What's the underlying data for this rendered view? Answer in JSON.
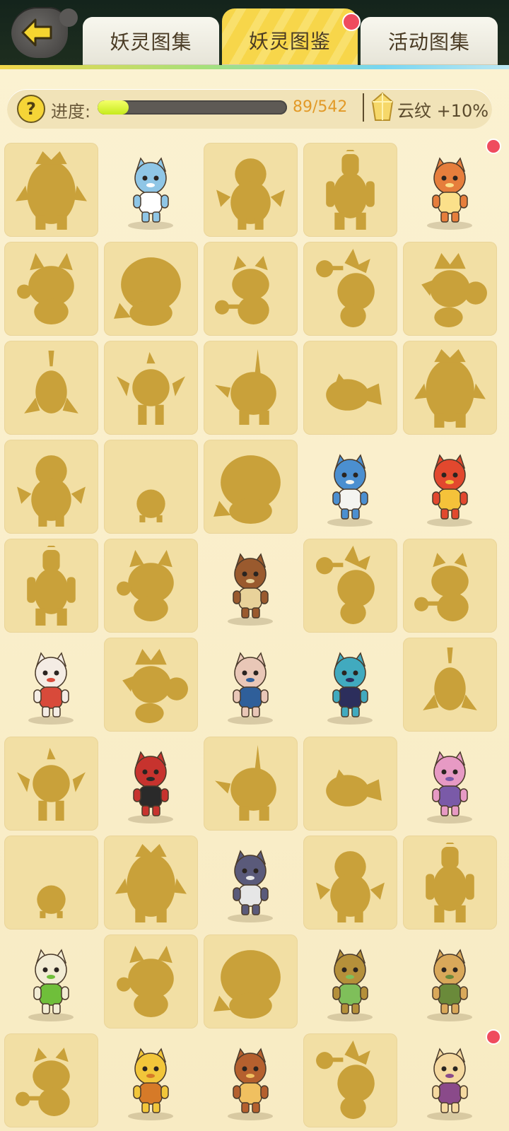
{
  "tabs": [
    {
      "label": "妖灵图集",
      "active": false
    },
    {
      "label": "妖灵图鉴",
      "active": true
    },
    {
      "label": "活动图集",
      "active": false
    }
  ],
  "progress": {
    "label": "进度:",
    "count_text": "89/542",
    "fraction": 0.164,
    "help_symbol": "?",
    "bonus_text": "云纹 +10%"
  },
  "colors": {
    "silhouette": "#c9a13a",
    "locked_bg": "#f2dfa4",
    "accent_yellow": "#f7d64a",
    "progress_green": "#c6ea1c",
    "count_orange": "#e29a28",
    "notify_red": "#ef4c5e"
  },
  "cells": [
    {
      "state": "locked",
      "icon": "monster-silhouette",
      "variant": 0
    },
    {
      "state": "unlocked",
      "icon": "blue-wolf-character",
      "color": "#8fc6e6",
      "accent": "#ffffff"
    },
    {
      "state": "locked",
      "icon": "monster-silhouette",
      "variant": 1
    },
    {
      "state": "locked",
      "icon": "monster-silhouette",
      "variant": 2
    },
    {
      "state": "unlocked",
      "icon": "red-panda-character",
      "color": "#e67e3c",
      "accent": "#fbe08a",
      "badge": true
    },
    {
      "state": "locked",
      "icon": "monster-silhouette",
      "variant": 3
    },
    {
      "state": "locked",
      "icon": "monster-silhouette",
      "variant": 4
    },
    {
      "state": "locked",
      "icon": "monster-silhouette",
      "variant": 5
    },
    {
      "state": "locked",
      "icon": "monster-silhouette",
      "variant": 6
    },
    {
      "state": "locked",
      "icon": "monster-silhouette",
      "variant": 7
    },
    {
      "state": "locked",
      "icon": "monster-silhouette",
      "variant": 8
    },
    {
      "state": "locked",
      "icon": "monster-silhouette",
      "variant": 9
    },
    {
      "state": "locked",
      "icon": "monster-silhouette",
      "variant": 10
    },
    {
      "state": "locked",
      "icon": "monster-silhouette",
      "variant": 11
    },
    {
      "state": "locked",
      "icon": "monster-silhouette",
      "variant": 0
    },
    {
      "state": "locked",
      "icon": "monster-silhouette",
      "variant": 1
    },
    {
      "state": "locked",
      "icon": "monster-silhouette",
      "variant": 12
    },
    {
      "state": "locked",
      "icon": "monster-silhouette",
      "variant": 4
    },
    {
      "state": "unlocked",
      "icon": "frog-staff-character",
      "color": "#4b8fd0",
      "accent": "#f4f4f0"
    },
    {
      "state": "unlocked",
      "icon": "red-lion-character",
      "color": "#e2482e",
      "accent": "#f5c23a"
    },
    {
      "state": "locked",
      "icon": "monster-silhouette",
      "variant": 2
    },
    {
      "state": "locked",
      "icon": "monster-silhouette",
      "variant": 3
    },
    {
      "state": "unlocked",
      "icon": "acorn-warrior-character",
      "color": "#9a5a2e",
      "accent": "#e8d29a"
    },
    {
      "state": "locked",
      "icon": "monster-silhouette",
      "variant": 6
    },
    {
      "state": "locked",
      "icon": "monster-silhouette",
      "variant": 5
    },
    {
      "state": "unlocked",
      "icon": "white-fox-character",
      "color": "#f4ece4",
      "accent": "#d84a3a"
    },
    {
      "state": "locked",
      "icon": "monster-silhouette",
      "variant": 7
    },
    {
      "state": "unlocked",
      "icon": "swordsman-character",
      "color": "#e9c7b7",
      "accent": "#2f5f9a"
    },
    {
      "state": "unlocked",
      "icon": "bomb-monk-character",
      "color": "#41aabf",
      "accent": "#2c2e5c"
    },
    {
      "state": "locked",
      "icon": "monster-silhouette",
      "variant": 8
    },
    {
      "state": "locked",
      "icon": "monster-silhouette",
      "variant": 9
    },
    {
      "state": "unlocked",
      "icon": "mouse-girl-character",
      "color": "#c7332e",
      "accent": "#2a2a2a"
    },
    {
      "state": "locked",
      "icon": "monster-silhouette",
      "variant": 10
    },
    {
      "state": "locked",
      "icon": "monster-silhouette",
      "variant": 11
    },
    {
      "state": "unlocked",
      "icon": "pink-sheep-character",
      "color": "#e79ac4",
      "accent": "#7a5aa8"
    },
    {
      "state": "locked",
      "icon": "monster-silhouette",
      "variant": 12
    },
    {
      "state": "locked",
      "icon": "monster-silhouette",
      "variant": 0
    },
    {
      "state": "unlocked",
      "icon": "wheel-ghost-character",
      "color": "#5a5a7a",
      "accent": "#e6e6e6"
    },
    {
      "state": "locked",
      "icon": "monster-silhouette",
      "variant": 1
    },
    {
      "state": "locked",
      "icon": "monster-silhouette",
      "variant": 2
    },
    {
      "state": "unlocked",
      "icon": "sprout-radish-character",
      "color": "#f2ecd4",
      "accent": "#6fbf3a"
    },
    {
      "state": "locked",
      "icon": "monster-silhouette",
      "variant": 3
    },
    {
      "state": "locked",
      "icon": "monster-silhouette",
      "variant": 4
    },
    {
      "state": "unlocked",
      "icon": "bamboo-drum-character",
      "color": "#b5903a",
      "accent": "#7fbf5a"
    },
    {
      "state": "unlocked",
      "icon": "axe-wood-golem-character",
      "color": "#d9a85a",
      "accent": "#6a8a3a"
    },
    {
      "state": "locked",
      "icon": "monster-silhouette",
      "variant": 5
    },
    {
      "state": "unlocked",
      "icon": "golden-duck-character",
      "color": "#f2c63a",
      "accent": "#d67a28"
    },
    {
      "state": "unlocked",
      "icon": "horned-warrior-character",
      "color": "#b5602e",
      "accent": "#f0c060"
    },
    {
      "state": "locked",
      "icon": "monster-silhouette",
      "variant": 6
    },
    {
      "state": "unlocked",
      "icon": "cream-cat-character",
      "color": "#f5d9a0",
      "accent": "#8a4a8a",
      "badge": true
    }
  ]
}
